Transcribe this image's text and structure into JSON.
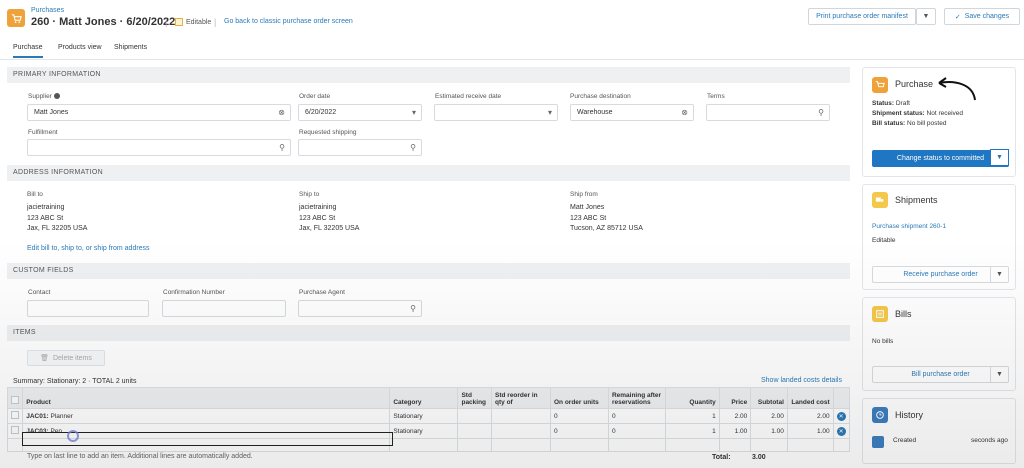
{
  "header": {
    "breadcrumb": "Purchases",
    "title": "260 · Matt Jones · 6/20/2022",
    "editable": "Editable",
    "go_back": "Go back to classic purchase order screen",
    "print_manifest": "Print purchase order manifest",
    "save": "Save changes"
  },
  "tabs": [
    "Purchase",
    "Products view",
    "Shipments"
  ],
  "primary": {
    "heading": "PRIMARY INFORMATION",
    "supplier_label": "Supplier",
    "supplier_value": "Matt Jones",
    "order_date_label": "Order date",
    "order_date_value": "6/20/2022",
    "est_receive_label": "Estimated receive date",
    "est_receive_value": "",
    "destination_label": "Purchase destination",
    "destination_value": "Warehouse",
    "terms_label": "Terms",
    "fulfillment_label": "Fulfillment",
    "requested_shipping_label": "Requested shipping"
  },
  "address": {
    "heading": "ADDRESS INFORMATION",
    "bill_to_label": "Bill to",
    "bill_to": [
      "jacietraining",
      "123 ABC St",
      "Jax, FL 32205 USA"
    ],
    "ship_to_label": "Ship to",
    "ship_to": [
      "jacietraining",
      "123 ABC St",
      "Jax, FL 32205 USA"
    ],
    "ship_from_label": "Ship from",
    "ship_from": [
      "Matt Jones",
      "123 ABC St",
      "Tucson, AZ 85712 USA"
    ],
    "edit_link": "Edit bill to, ship to, or ship from address"
  },
  "custom": {
    "heading": "CUSTOM FIELDS",
    "contact_label": "Contact",
    "confirmation_label": "Confirmation Number",
    "agent_label": "Purchase Agent"
  },
  "items": {
    "heading": "ITEMS",
    "delete": "Delete items",
    "summary": "Summary: Stationary: 2 · TOTAL 2 units",
    "show_landed": "Show landed costs details",
    "columns": [
      "Product",
      "Category",
      "Std packing",
      "Std reorder in qty of",
      "On order units",
      "Remaining after reservations",
      "Quantity",
      "Price",
      "Subtotal",
      "Landed cost"
    ],
    "rows": [
      {
        "sku": "JAC01:",
        "name": "Planner",
        "category": "Stationary",
        "on_order": "0",
        "remaining": "0",
        "qty": "1",
        "price": "2.00",
        "subtotal": "2.00",
        "landed": "2.00"
      },
      {
        "sku": "JAC03:",
        "name": "Pen",
        "category": "Stationary",
        "on_order": "0",
        "remaining": "0",
        "qty": "1",
        "price": "1.00",
        "subtotal": "1.00",
        "landed": "1.00"
      }
    ],
    "hint": "Type on last line to add an item. Additional lines are automatically added.",
    "total_label": "Total:",
    "total_value": "3.00"
  },
  "sidebar": {
    "purchase": {
      "title": "Purchase",
      "status_label": "Status:",
      "status_value": "Draft",
      "shipment_label": "Shipment status:",
      "shipment_value": "Not received",
      "bill_label": "Bill status:",
      "bill_value": "No bill posted",
      "button": "Change status to committed"
    },
    "shipments": {
      "title": "Shipments",
      "link": "Purchase shipment 260-1",
      "status": "Editable",
      "button": "Receive purchase order"
    },
    "bills": {
      "title": "Bills",
      "text": "No bills",
      "button": "Bill purchase order"
    },
    "history": {
      "title": "History",
      "event": "Created",
      "time": "seconds ago"
    }
  },
  "colors": {
    "accent": "#2a7ab8",
    "primary_button": "#1f76c2",
    "brand_orange": "#f0a23a"
  }
}
